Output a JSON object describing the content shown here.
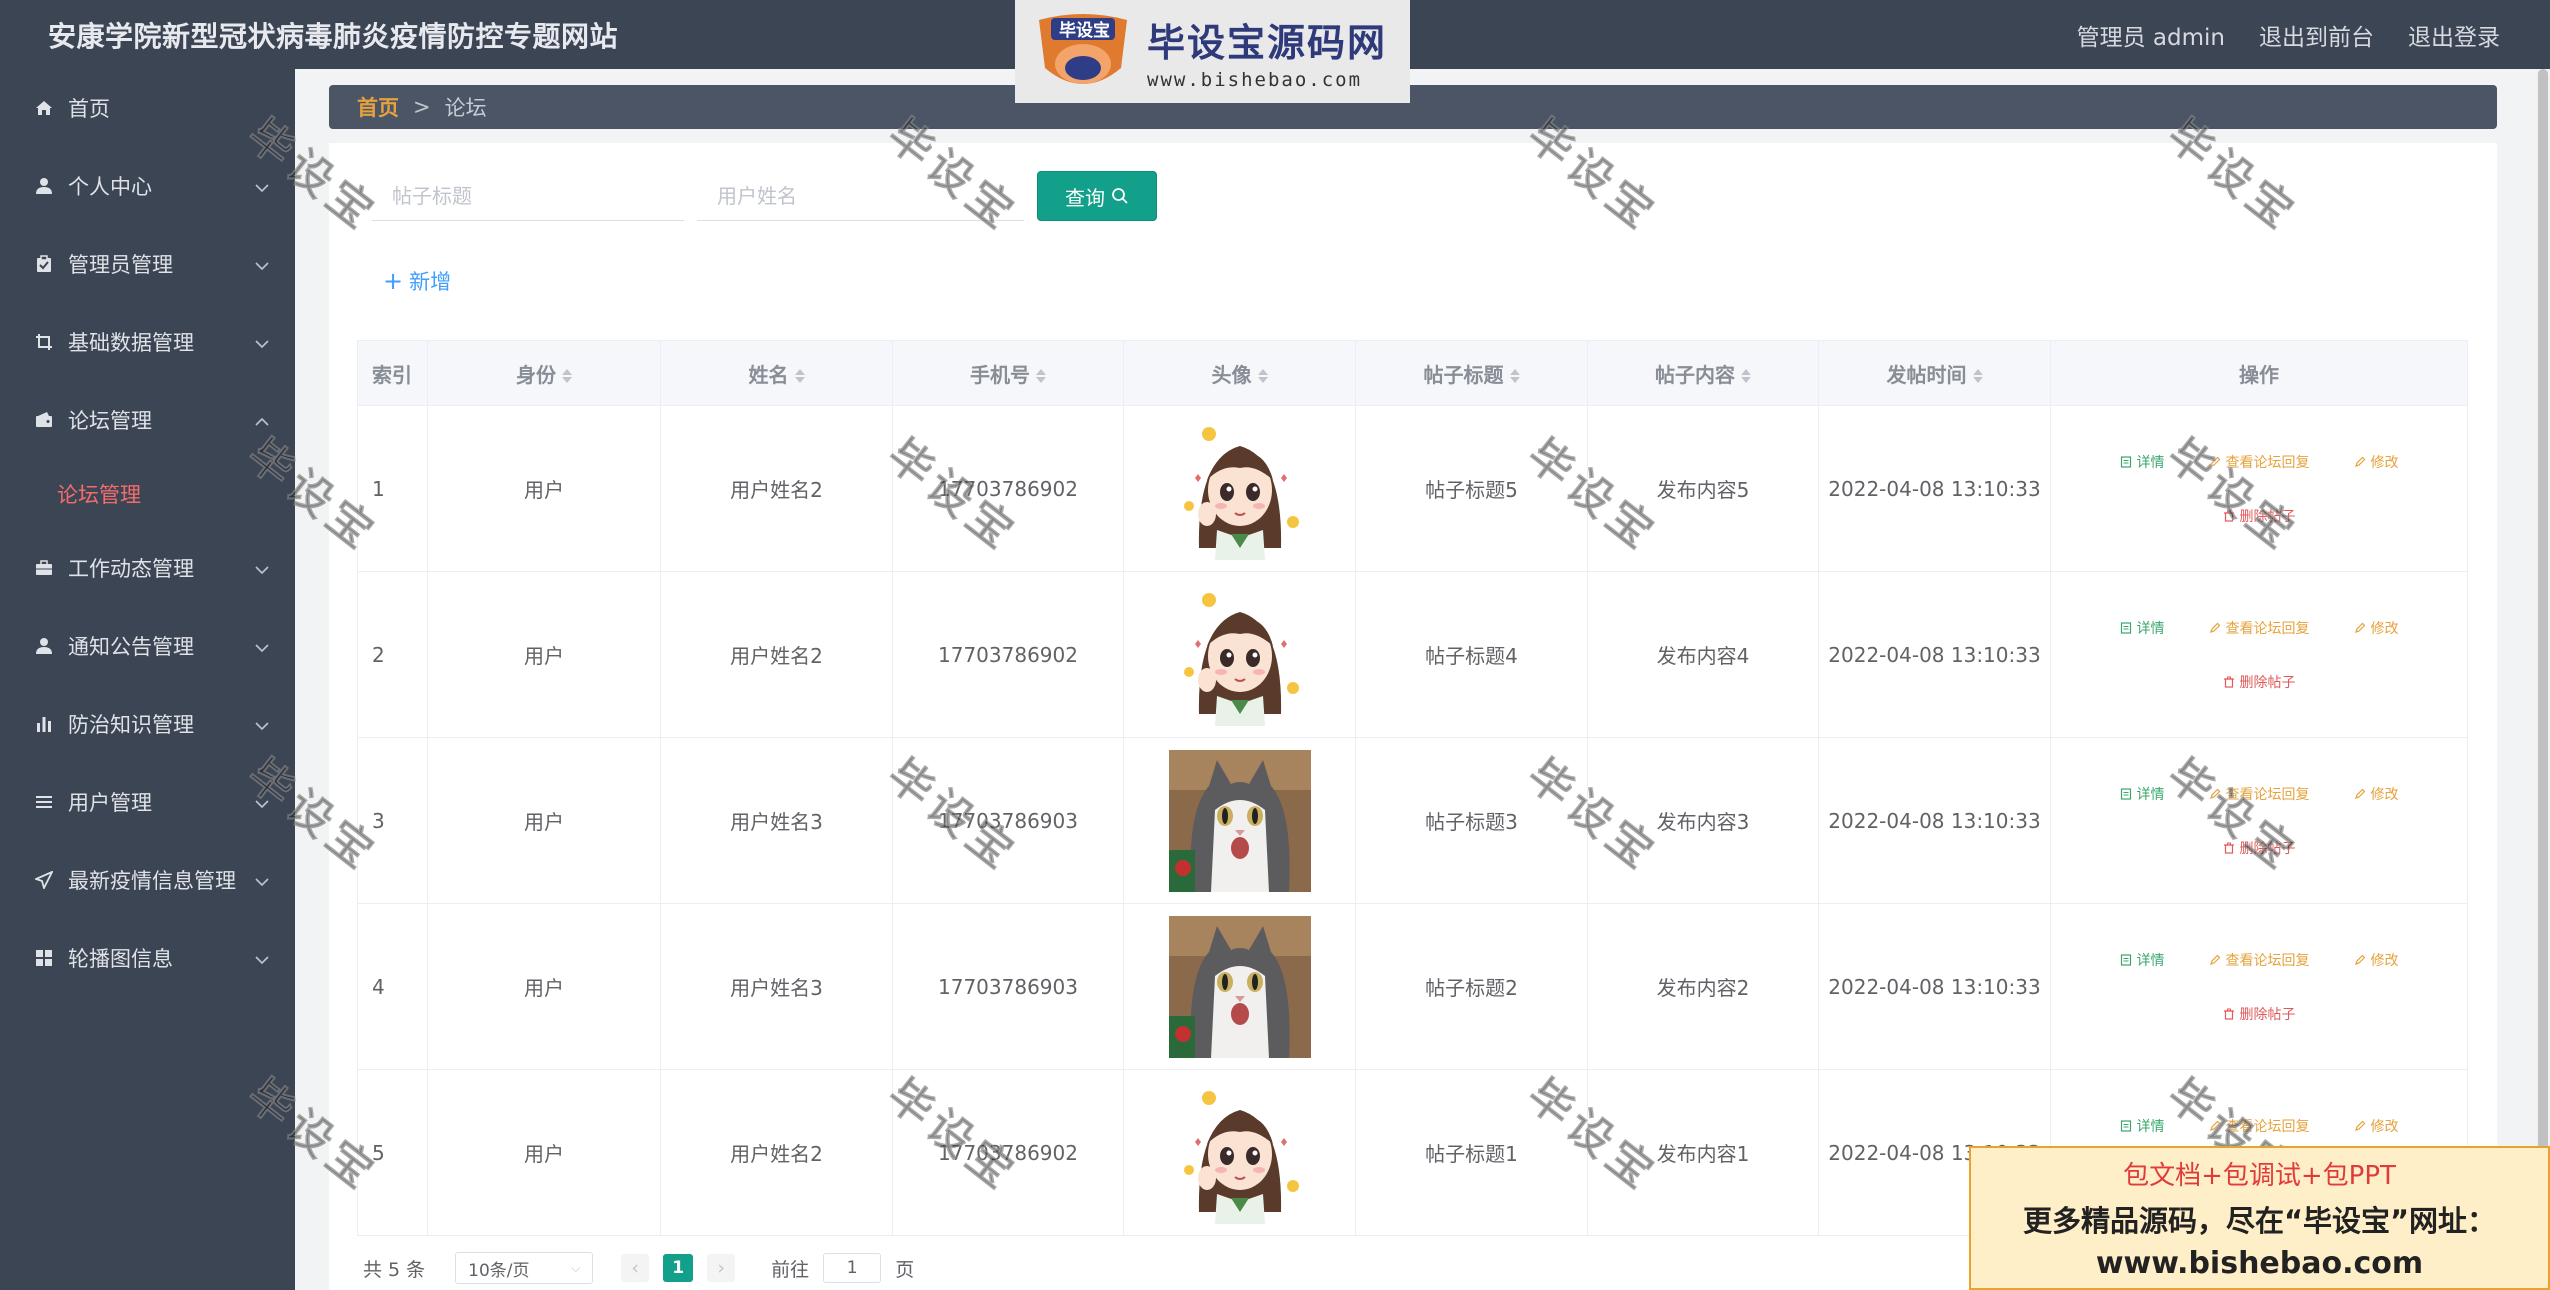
{
  "header": {
    "site_title": "安康学院新型冠状病毒肺炎疫情防控专题网站",
    "admin_label": "管理员 admin",
    "exit_to_front": "退出到前台",
    "logout": "退出登录"
  },
  "sidebar": {
    "items": [
      {
        "label": "首页",
        "icon": "home-icon"
      },
      {
        "label": "个人中心",
        "icon": "user-icon"
      },
      {
        "label": "管理员管理",
        "icon": "clipboard-icon"
      },
      {
        "label": "基础数据管理",
        "icon": "crop-icon"
      },
      {
        "label": "论坛管理",
        "icon": "wallet-icon"
      },
      {
        "label": "工作动态管理",
        "icon": "briefcase-icon"
      },
      {
        "label": "通知公告管理",
        "icon": "user-icon"
      },
      {
        "label": "防治知识管理",
        "icon": "bar-chart-icon"
      },
      {
        "label": "用户管理",
        "icon": "list-icon"
      },
      {
        "label": "最新疫情信息管理",
        "icon": "send-icon"
      },
      {
        "label": "轮播图信息",
        "icon": "grid-icon"
      }
    ],
    "submenu_active": "论坛管理"
  },
  "breadcrumb": {
    "home": "首页",
    "separator": ">",
    "current": "论坛"
  },
  "search": {
    "title_placeholder": "帖子标题",
    "username_placeholder": "用户姓名",
    "query_label": "查询"
  },
  "add_label": "新增",
  "table": {
    "columns": [
      "索引",
      "身份",
      "姓名",
      "手机号",
      "头像",
      "帖子标题",
      "帖子内容",
      "发帖时间",
      "操作"
    ],
    "rows": [
      {
        "index": "1",
        "role": "用户",
        "name": "用户姓名2",
        "phone": "17703786902",
        "avatar": "girl",
        "title": "帖子标题5",
        "content": "发布内容5",
        "time": "2022-04-08 13:10:33"
      },
      {
        "index": "2",
        "role": "用户",
        "name": "用户姓名2",
        "phone": "17703786902",
        "avatar": "girl",
        "title": "帖子标题4",
        "content": "发布内容4",
        "time": "2022-04-08 13:10:33"
      },
      {
        "index": "3",
        "role": "用户",
        "name": "用户姓名3",
        "phone": "17703786903",
        "avatar": "cat",
        "title": "帖子标题3",
        "content": "发布内容3",
        "time": "2022-04-08 13:10:33"
      },
      {
        "index": "4",
        "role": "用户",
        "name": "用户姓名3",
        "phone": "17703786903",
        "avatar": "cat",
        "title": "帖子标题2",
        "content": "发布内容2",
        "time": "2022-04-08 13:10:33"
      },
      {
        "index": "5",
        "role": "用户",
        "name": "用户姓名2",
        "phone": "17703786902",
        "avatar": "girl",
        "title": "帖子标题1",
        "content": "发布内容1",
        "time": "2022-04-08 13:10:33"
      }
    ],
    "ops": {
      "detail": "详情",
      "view_reply": "查看论坛回复",
      "edit": "修改",
      "delete": "删除帖子"
    }
  },
  "pagination": {
    "total": "共 5 条",
    "page_size": "10条/页",
    "current_page": "1",
    "goto_prefix": "前往",
    "goto_value": "1",
    "goto_suffix": "页"
  },
  "watermark": {
    "logo_badge": "毕设宝",
    "logo_main": "毕设宝源码网",
    "logo_url": "www.bishebao.com",
    "diagonal_text": "毕设宝",
    "promo_line1": "包文档+包调试+包PPT",
    "promo_line2": "更多精品源码，尽在“毕设宝”网址：",
    "promo_line3": "www.bishebao.com"
  },
  "colors": {
    "header_bg": "#3c4554",
    "accent_green": "#13a08a",
    "active_red": "#f56c6c",
    "breadcrumb_home": "#e6a23c"
  }
}
